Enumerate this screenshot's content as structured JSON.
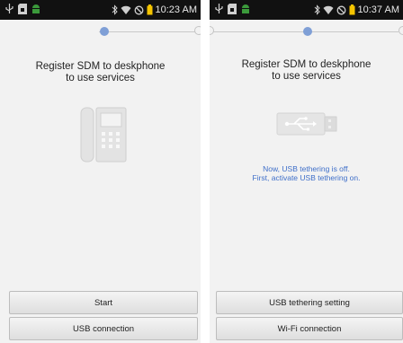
{
  "left_screen": {
    "status_time": "10:23 AM",
    "heading_line1": "Register SDM to deskphone",
    "heading_line2": "to use services",
    "illustration_icon": "deskphone-icon",
    "buttons": {
      "start": "Start",
      "usb_connection": "USB connection"
    }
  },
  "right_screen": {
    "status_time": "10:37 AM",
    "heading_line1": "Register SDM to deskphone",
    "heading_line2": "to use services",
    "illustration_icon": "usb-icon",
    "notice_line1": "Now, USB tethering is off.",
    "notice_line2": "First, activate USB tethering on.",
    "buttons": {
      "usb_tethering_setting": "USB tethering setting",
      "wifi_connection": "Wi-Fi connection"
    }
  },
  "colors": {
    "status_bar": "#111111",
    "background": "#f2f2f2",
    "active_step": "#7f9fd6",
    "notice_text": "#3f6fc9",
    "battery": "#f5c400"
  }
}
